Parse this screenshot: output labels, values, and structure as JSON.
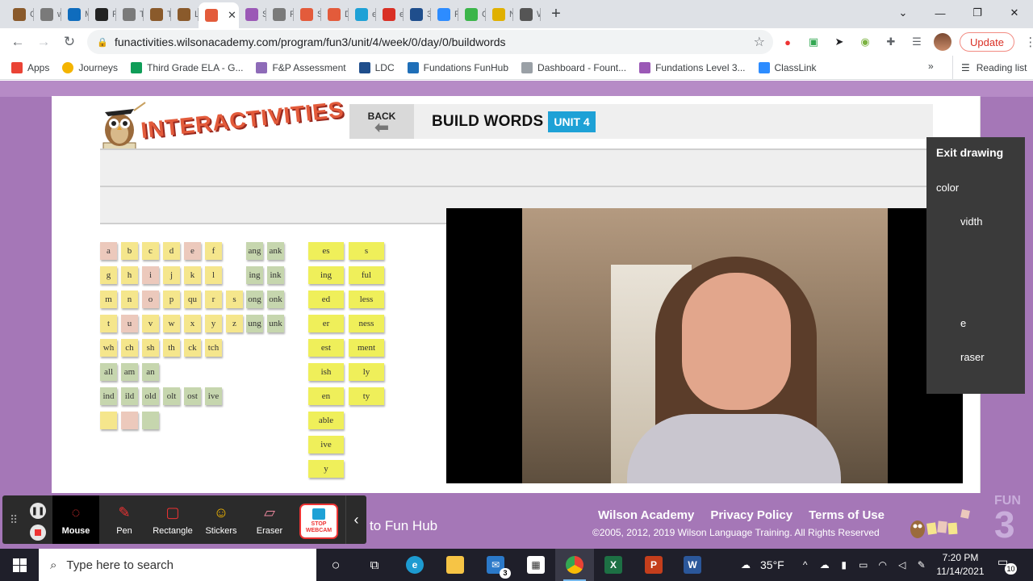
{
  "tabs": [
    {
      "label": "Gr",
      "icon": "owl-icon",
      "color": "#8a5a2b"
    },
    {
      "label": "wv",
      "icon": "globe-icon",
      "color": "#7a7a7a"
    },
    {
      "label": "M",
      "icon": "outlook-icon",
      "color": "#0f6cbd"
    },
    {
      "label": "Fri",
      "icon": "s-icon",
      "color": "#222222"
    },
    {
      "label": "Th",
      "icon": "globe-icon",
      "color": "#7a7a7a"
    },
    {
      "label": "Te",
      "icon": "owl-icon",
      "color": "#8a5a2b"
    },
    {
      "label": "Le",
      "icon": "owl-icon",
      "color": "#8a5a2b"
    },
    {
      "label": "",
      "icon": "in-icon",
      "color": "#e35b3b",
      "active": true
    },
    {
      "label": "St",
      "icon": "i3-icon",
      "color": "#9b59b6"
    },
    {
      "label": "F2",
      "icon": "globe-icon",
      "color": "#7a7a7a"
    },
    {
      "label": "Se",
      "icon": "in-icon",
      "color": "#e35b3b"
    },
    {
      "label": "Dr",
      "icon": "in-icon",
      "color": "#e35b3b"
    },
    {
      "label": "eS",
      "icon": "pin-icon",
      "color": "#1ea1d6"
    },
    {
      "label": "eS",
      "icon": "esd-icon",
      "color": "#d93025"
    },
    {
      "label": "3r",
      "icon": "ldc-icon",
      "color": "#1f4e8c"
    },
    {
      "label": "Po",
      "icon": "zoom-icon",
      "color": "#2d8cff"
    },
    {
      "label": "Cl",
      "icon": "classlink-icon",
      "color": "#3bb54a"
    },
    {
      "label": "N\\",
      "icon": "n-icon",
      "color": "#e0b000"
    },
    {
      "label": "Wi",
      "icon": "globe-icon",
      "color": "#555555"
    }
  ],
  "browser": {
    "url": "funactivities.wilsonacademy.com/program/fun3/unit/4/week/0/day/0/buildwords",
    "update_label": "Update"
  },
  "bookmarks": [
    {
      "label": "Apps",
      "icon": "apps-icon",
      "color": "#ea4335"
    },
    {
      "label": "Journeys",
      "icon": "journeys-icon",
      "color": "#f4b400"
    },
    {
      "label": "Third Grade ELA - G...",
      "icon": "drive-icon",
      "color": "#0f9d58"
    },
    {
      "label": "F&P Assessment",
      "icon": "fp-icon",
      "color": "#8e6bb8"
    },
    {
      "label": "LDC",
      "icon": "ldc-icon",
      "color": "#1f4e8c"
    },
    {
      "label": "Fundations FunHub",
      "icon": "w-icon",
      "color": "#1f6fb8"
    },
    {
      "label": "Dashboard - Fount...",
      "icon": "doc-icon",
      "color": "#9aa0a6"
    },
    {
      "label": "Fundations Level 3...",
      "icon": "i3-icon",
      "color": "#9b59b6"
    },
    {
      "label": "ClassLink",
      "icon": "classlink-icon",
      "color": "#2d8cff"
    }
  ],
  "bookmarks_more": "»",
  "reading_list": "Reading list",
  "app": {
    "logo_text": "INTERACTIVITIES",
    "back_label": "BACK",
    "title": "BUILD WORDS",
    "unit": "UNIT 4"
  },
  "tiles": {
    "letters": [
      [
        "a",
        "b",
        "c",
        "d",
        "e",
        "f"
      ],
      [
        "g",
        "h",
        "i",
        "j",
        "k",
        "l"
      ],
      [
        "m",
        "n",
        "o",
        "p",
        "qu",
        "r",
        "s"
      ],
      [
        "t",
        "u",
        "v",
        "w",
        "x",
        "y",
        "z"
      ],
      [
        "wh",
        "ch",
        "sh",
        "th",
        "ck",
        "tch"
      ],
      [
        "all",
        "am",
        "an"
      ],
      [
        "ind",
        "ild",
        "old",
        "olt",
        "ost",
        "ive"
      ],
      [
        "",
        "",
        ""
      ]
    ],
    "letter_colors": [
      [
        "pink",
        "yellow",
        "yellow",
        "yellow",
        "pink",
        "yellow"
      ],
      [
        "yellow",
        "yellow",
        "pink",
        "yellow",
        "yellow",
        "yellow"
      ],
      [
        "yellow",
        "yellow",
        "pink",
        "yellow",
        "yellow",
        "yellow",
        "yellow"
      ],
      [
        "yellow",
        "pink",
        "yellow",
        "yellow",
        "yellow",
        "yellow",
        "yellow"
      ],
      [
        "yellow",
        "yellow",
        "yellow",
        "yellow",
        "yellow",
        "yellow"
      ],
      [
        "green",
        "green",
        "green"
      ],
      [
        "green",
        "green",
        "green",
        "green",
        "green",
        "green"
      ],
      [
        "yellow",
        "pink",
        "green"
      ]
    ],
    "glued": [
      [
        "ang",
        "ank"
      ],
      [
        "ing",
        "ink"
      ],
      [
        "ong",
        "onk"
      ],
      [
        "ung",
        "unk"
      ]
    ],
    "suffix_left": [
      "es",
      "ing",
      "ed",
      "er",
      "est",
      "ish",
      "en",
      "able",
      "ive",
      "y"
    ],
    "suffix_right": [
      "s",
      "ful",
      "less",
      "ness",
      "ment",
      "ly",
      "ty"
    ]
  },
  "draw_panel": {
    "exit": "Exit drawing",
    "items": [
      "color",
      "width",
      "",
      "",
      "e",
      "raser"
    ],
    "visible_items": [
      "color",
      "vidth",
      "e",
      "raser"
    ]
  },
  "fun3": {
    "a": "FUN",
    "b": "3"
  },
  "footer": {
    "hub_partial": "to Fun Hub",
    "links": [
      "Wilson Academy",
      "Privacy Policy",
      "Terms of Use"
    ],
    "copyright": "©2005, 2012, 2019 Wilson Language Training. All Rights Reserved"
  },
  "capture_toolbar": {
    "tools": [
      {
        "label": "Mouse",
        "icon": "cursor-icon",
        "active": true
      },
      {
        "label": "Pen",
        "icon": "pen-icon"
      },
      {
        "label": "Rectangle",
        "icon": "rectangle-icon"
      },
      {
        "label": "Stickers",
        "icon": "sticker-icon"
      },
      {
        "label": "Eraser",
        "icon": "eraser-icon"
      }
    ],
    "webcam_label_1": "STOP",
    "webcam_label_2": "WEBCAM"
  },
  "taskbar": {
    "search_placeholder": "Type here to search",
    "weather": "35°F",
    "time": "7:20 PM",
    "date": "11/14/2021",
    "notifications": "10",
    "mail_badge": "3"
  },
  "colors": {
    "purple_bg": "#a577b7",
    "accent_blue": "#1ea1d6",
    "tile_pink": "#ecc9bc",
    "tile_yellow": "#f5e68c",
    "tile_green": "#c6d6ae",
    "tile_lime": "#efef5a"
  }
}
